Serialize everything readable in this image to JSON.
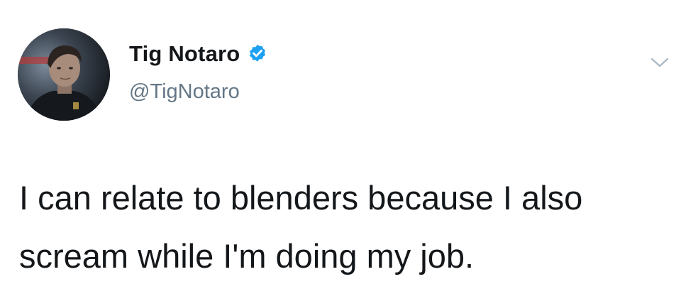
{
  "author": {
    "display_name": "Tig Notaro",
    "handle": "@TigNotaro",
    "verified": true,
    "avatar": "profile-photo"
  },
  "tweet": {
    "lines": [
      "I can relate to blenders because I also",
      "scream while I'm doing my job."
    ]
  },
  "icons": {
    "verified": "verified-badge-icon",
    "menu": "chevron-down-icon"
  },
  "colors": {
    "verified_blue": "#1da1f2",
    "text": "#14171a",
    "secondary_text": "#657786",
    "caret": "#aab8c2",
    "background": "#ffffff"
  }
}
